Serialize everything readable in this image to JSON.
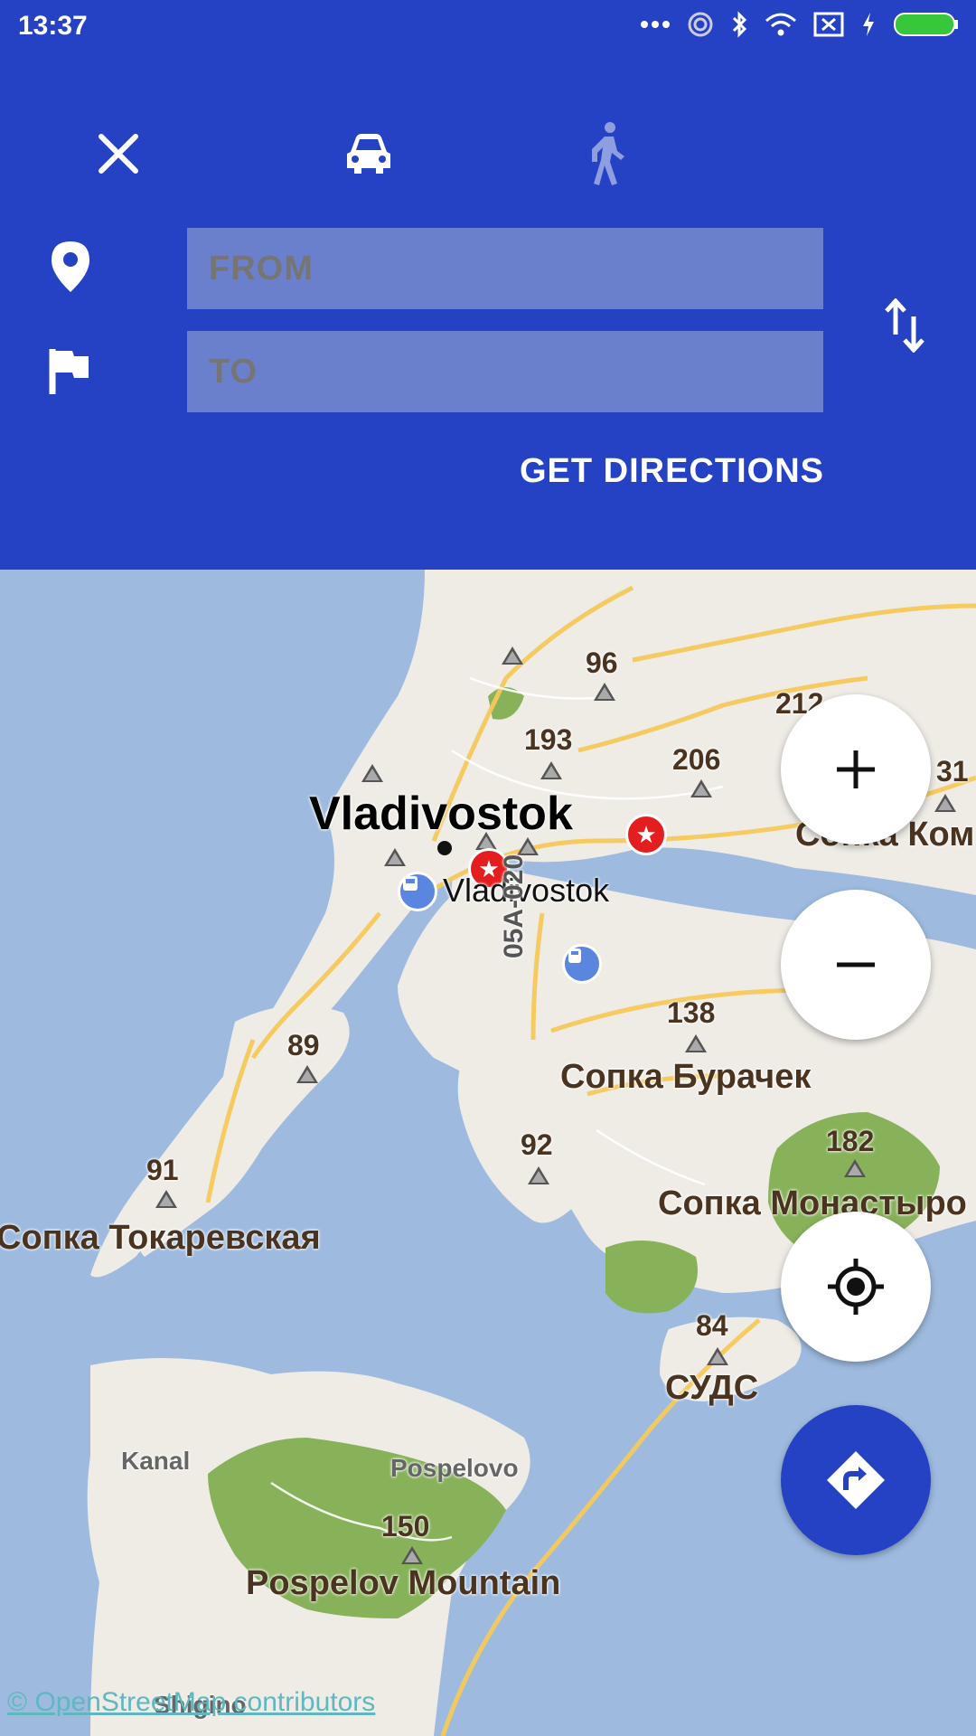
{
  "status": {
    "time": "13:37"
  },
  "header": {
    "from_placeholder": "FROM",
    "to_placeholder": "TO",
    "get_directions": "GET DIRECTIONS"
  },
  "map": {
    "labels": {
      "vladivostok_big": "Vladivostok",
      "vladivostok_station": "Vladivostok",
      "road": "05A-020",
      "buracheck": "Сопка Бурачек",
      "monastyr": "Сопка Монастыро",
      "tokarevskaya": "Сопка Токаревская",
      "suds": "СУДС",
      "kom": "Сопка Ком",
      "pospelovo": "Pospelovo",
      "kanal": "Kanal",
      "pospelov_mountain": "Pospelov Mountain",
      "shigino": "Shigino"
    },
    "peaks": {
      "p96": "96",
      "p193": "193",
      "p206": "206",
      "p212": "212",
      "p31": "31",
      "p138": "138",
      "p89": "89",
      "p92": "92",
      "p182": "182",
      "p91": "91",
      "p84": "84",
      "p150": "150"
    },
    "attribution": "© OpenStreetMap contributors"
  },
  "colors": {
    "primary": "#2541c4",
    "field": "#6b80cd",
    "water": "#9ebbdf",
    "land": "#f2efe9",
    "park": "#88b25a"
  }
}
